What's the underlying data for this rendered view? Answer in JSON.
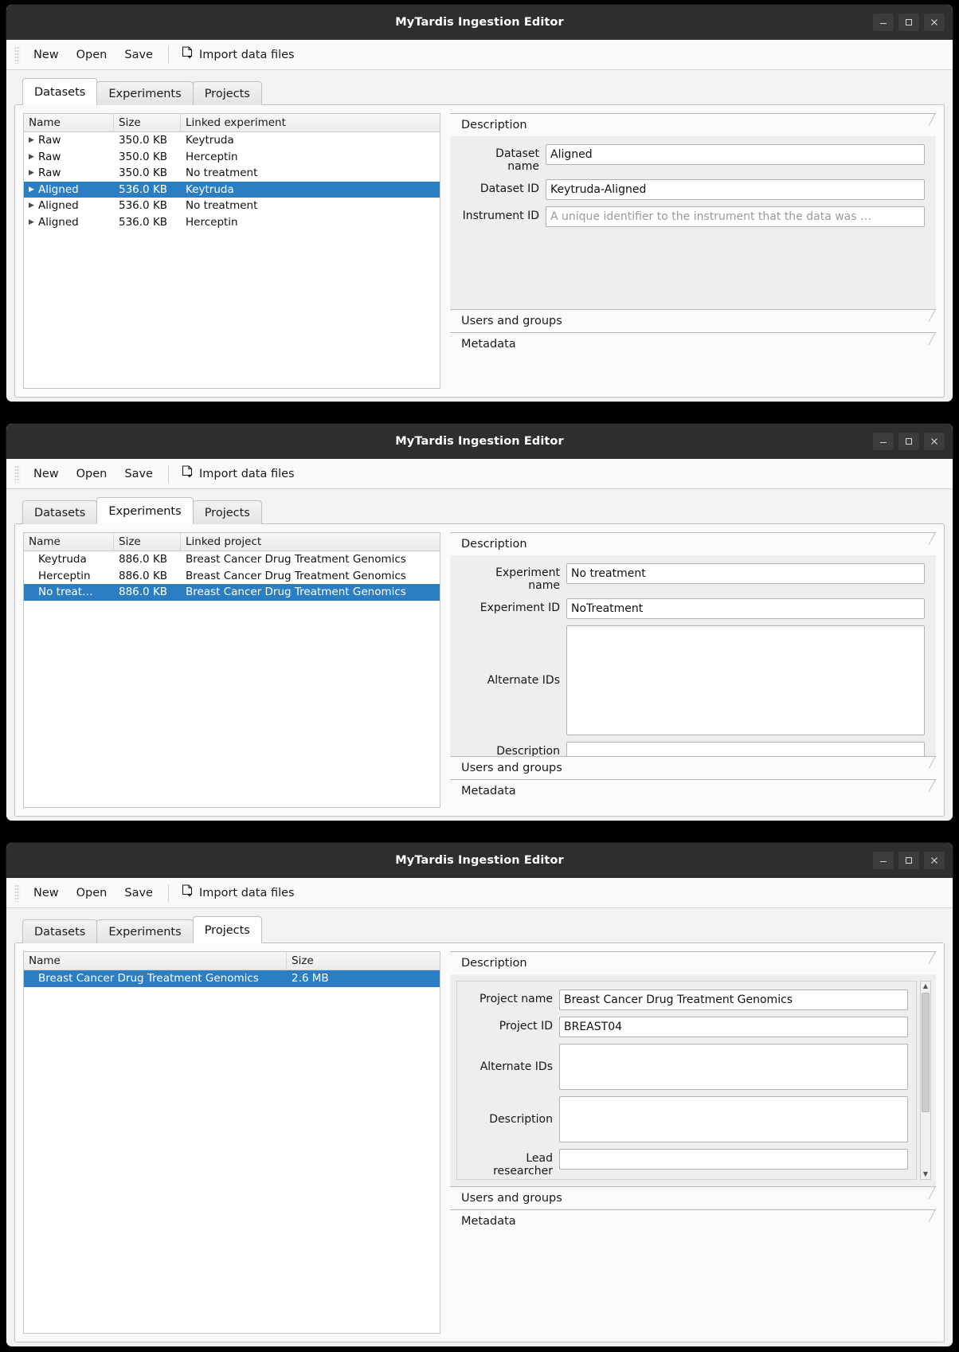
{
  "app": {
    "title": "MyTardis Ingestion Editor",
    "window_buttons": {
      "minimize": "minimize-label",
      "maximize": "maximize-label",
      "close": "close-label"
    }
  },
  "toolbar": {
    "new": "New",
    "open": "Open",
    "save": "Save",
    "import": "Import data files"
  },
  "tabs": {
    "datasets": "Datasets",
    "experiments": "Experiments",
    "projects": "Projects"
  },
  "sections": {
    "description": "Description",
    "users_and_groups": "Users and groups",
    "metadata": "Metadata"
  },
  "colors": {
    "selection": "#2b7ec1",
    "titlebar": "#2e2e2e",
    "panel": "#eeeeee"
  },
  "window_datasets": {
    "active_tab": "Datasets",
    "table": {
      "headers": [
        "Name",
        "Size",
        "Linked experiment"
      ],
      "rows": [
        {
          "name": "Raw",
          "size": "350.0 KB",
          "linked": "Keytruda",
          "selected": false
        },
        {
          "name": "Raw",
          "size": "350.0 KB",
          "linked": "Herceptin",
          "selected": false
        },
        {
          "name": "Raw",
          "size": "350.0 KB",
          "linked": "No treatment",
          "selected": false
        },
        {
          "name": "Aligned",
          "size": "536.0 KB",
          "linked": "Keytruda",
          "selected": true
        },
        {
          "name": "Aligned",
          "size": "536.0 KB",
          "linked": "No treatment",
          "selected": false
        },
        {
          "name": "Aligned",
          "size": "536.0 KB",
          "linked": "Herceptin",
          "selected": false
        }
      ]
    },
    "fields": {
      "dataset_name_label": "Dataset name",
      "dataset_name_value": "Aligned",
      "dataset_id_label": "Dataset ID",
      "dataset_id_value": "Keytruda-Aligned",
      "instrument_id_label": "Instrument ID",
      "instrument_id_placeholder": "A unique identifier to the instrument that the data was …"
    }
  },
  "window_experiments": {
    "active_tab": "Experiments",
    "table": {
      "headers": [
        "Name",
        "Size",
        "Linked project"
      ],
      "rows": [
        {
          "name": "Keytruda",
          "size": "886.0 KB",
          "linked": "Breast Cancer Drug Treatment Genomics",
          "selected": false
        },
        {
          "name": "Herceptin",
          "size": "886.0 KB",
          "linked": "Breast Cancer Drug Treatment Genomics",
          "selected": false
        },
        {
          "name": "No treat…",
          "size": "886.0 KB",
          "linked": "Breast Cancer Drug Treatment Genomics",
          "selected": true
        }
      ]
    },
    "fields": {
      "experiment_name_label": "Experiment name",
      "experiment_name_value": "No treatment",
      "experiment_id_label": "Experiment ID",
      "experiment_id_value": "NoTreatment",
      "alternate_ids_label": "Alternate IDs",
      "alternate_ids_value": "",
      "description_label": "Description",
      "description_value": ""
    }
  },
  "window_projects": {
    "active_tab": "Projects",
    "table": {
      "headers": [
        "Name",
        "Size"
      ],
      "rows": [
        {
          "name": "Breast Cancer Drug Treatment Genomics",
          "size": "2.6 MB",
          "selected": true
        }
      ]
    },
    "fields": {
      "project_name_label": "Project name",
      "project_name_value": "Breast Cancer Drug Treatment Genomics",
      "project_id_label": "Project ID",
      "project_id_value": "BREAST04",
      "alternate_ids_label": "Alternate IDs",
      "alternate_ids_value": "",
      "description_label": "Description",
      "description_value": "",
      "lead_researcher_label": "Lead researcher",
      "lead_researcher_value": ""
    }
  }
}
